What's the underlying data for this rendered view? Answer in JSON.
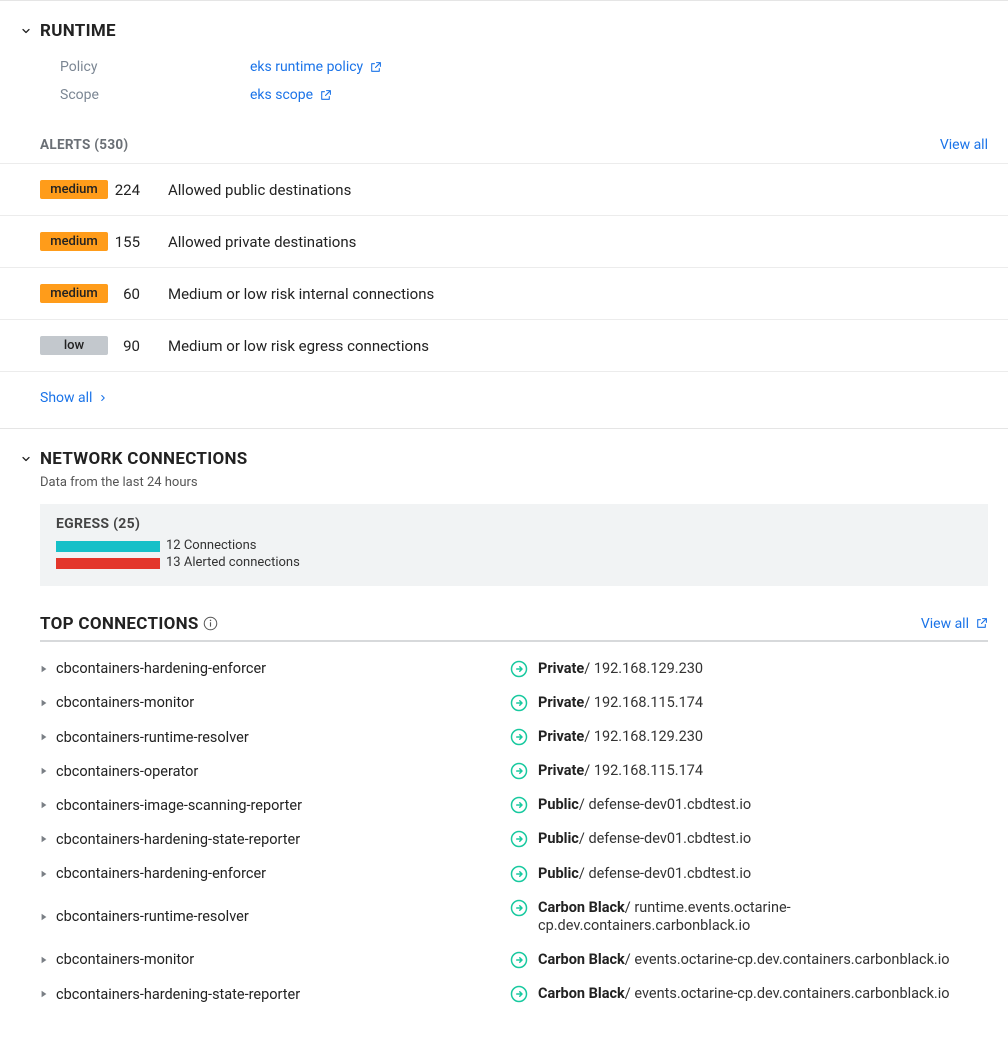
{
  "runtime": {
    "title": "RUNTIME",
    "policy_label": "Policy",
    "scope_label": "Scope",
    "policy_link": "eks runtime policy",
    "scope_link": "eks scope",
    "alerts_header": "ALERTS (530)",
    "view_all": "View all",
    "show_all": "Show all",
    "alerts": [
      {
        "severity": "medium",
        "count": "224",
        "desc": "Allowed public destinations"
      },
      {
        "severity": "medium",
        "count": "155",
        "desc": "Allowed private destinations"
      },
      {
        "severity": "medium",
        "count": "60",
        "desc": "Medium or low risk internal connections"
      },
      {
        "severity": "low",
        "count": "90",
        "desc": "Medium or low risk egress connections"
      }
    ]
  },
  "network": {
    "title": "NETWORK CONNECTIONS",
    "subtitle": "Data from the last 24 hours",
    "egress_title": "EGRESS (25)",
    "legend_connections": "12 Connections",
    "legend_alerted": "13 Alerted connections"
  },
  "topconn": {
    "title": "TOP CONNECTIONS",
    "view_all": "View all",
    "rows": [
      {
        "name": "cbcontainers-hardening-enforcer",
        "group": "Private",
        "addr": "192.168.129.230"
      },
      {
        "name": "cbcontainers-monitor",
        "group": "Private",
        "addr": "192.168.115.174"
      },
      {
        "name": "cbcontainers-runtime-resolver",
        "group": "Private",
        "addr": "192.168.129.230"
      },
      {
        "name": "cbcontainers-operator",
        "group": "Private",
        "addr": "192.168.115.174"
      },
      {
        "name": "cbcontainers-image-scanning-reporter",
        "group": "Public",
        "addr": "defense-dev01.cbdtest.io"
      },
      {
        "name": "cbcontainers-hardening-state-reporter",
        "group": "Public",
        "addr": "defense-dev01.cbdtest.io"
      },
      {
        "name": "cbcontainers-hardening-enforcer",
        "group": "Public",
        "addr": "defense-dev01.cbdtest.io"
      },
      {
        "name": "cbcontainers-runtime-resolver",
        "group": "Carbon Black",
        "addr": "runtime.events.octarine-cp.dev.containers.carbonblack.io"
      },
      {
        "name": "cbcontainers-monitor",
        "group": "Carbon Black",
        "addr": "events.octarine-cp.dev.containers.carbonblack.io"
      },
      {
        "name": "cbcontainers-hardening-state-reporter",
        "group": "Carbon Black",
        "addr": "events.octarine-cp.dev.containers.carbonblack.io"
      }
    ]
  }
}
